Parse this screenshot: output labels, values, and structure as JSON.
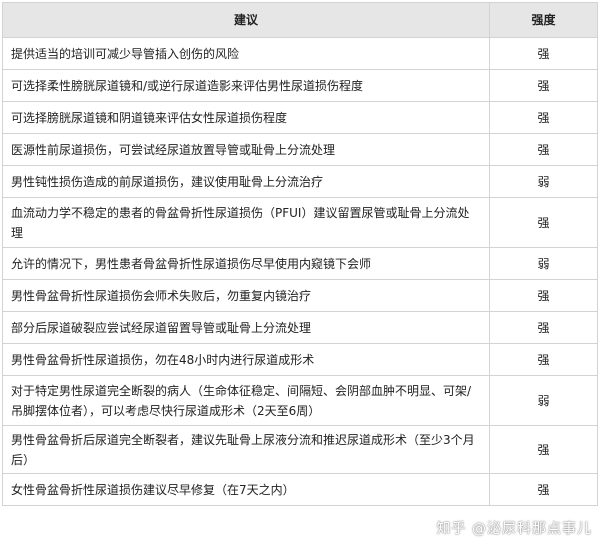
{
  "table": {
    "headers": [
      "建议",
      "强度"
    ],
    "rows": [
      {
        "text": "提供适当的培训可减少导管插入创伤的风险",
        "grade": "强"
      },
      {
        "text": "可选择柔性膀胱尿道镜和/或逆行尿道造影来评估男性尿道损伤程度",
        "grade": "强"
      },
      {
        "text": "可选择膀胱尿道镜和阴道镜来评估女性尿道损伤程度",
        "grade": "强"
      },
      {
        "text": "医源性前尿道损伤，可尝试经尿道放置导管或耻骨上分流处理",
        "grade": "强"
      },
      {
        "text": "男性钝性损伤造成的前尿道损伤，建议使用耻骨上分流治疗",
        "grade": "弱"
      },
      {
        "text": "血流动力学不稳定的患者的骨盆骨折性尿道损伤（PFUI）建议留置尿管或耻骨上分流处理",
        "grade": "强"
      },
      {
        "text": "允许的情况下，男性患者骨盆骨折性尿道损伤尽早使用内窥镜下会师",
        "grade": "弱"
      },
      {
        "text": "男性骨盆骨折性尿道损伤会师术失败后，勿重复内镜治疗",
        "grade": "强"
      },
      {
        "text": "部分后尿道破裂应尝试经尿道留置导管或耻骨上分流处理",
        "grade": "强"
      },
      {
        "text": "男性骨盆骨折性尿道损伤，勿在48小时内进行尿道成形术",
        "grade": "强"
      },
      {
        "text": "对于特定男性尿道完全断裂的病人（生命体征稳定、间隔短、会阴部血肿不明显、可架/吊脚摆体位者），可以考虑尽快行尿道成形术（2天至6周）",
        "grade": "弱"
      },
      {
        "text": "男性骨盆骨折后尿道完全断裂者，建议先耻骨上尿液分流和推迟尿道成形术（至少3个月后）",
        "grade": "强"
      },
      {
        "text": "女性骨盆骨折性尿道损伤建议尽早修复（在7天之内）",
        "grade": "强"
      }
    ]
  },
  "watermark": "知乎 @泌尿科那点事儿"
}
